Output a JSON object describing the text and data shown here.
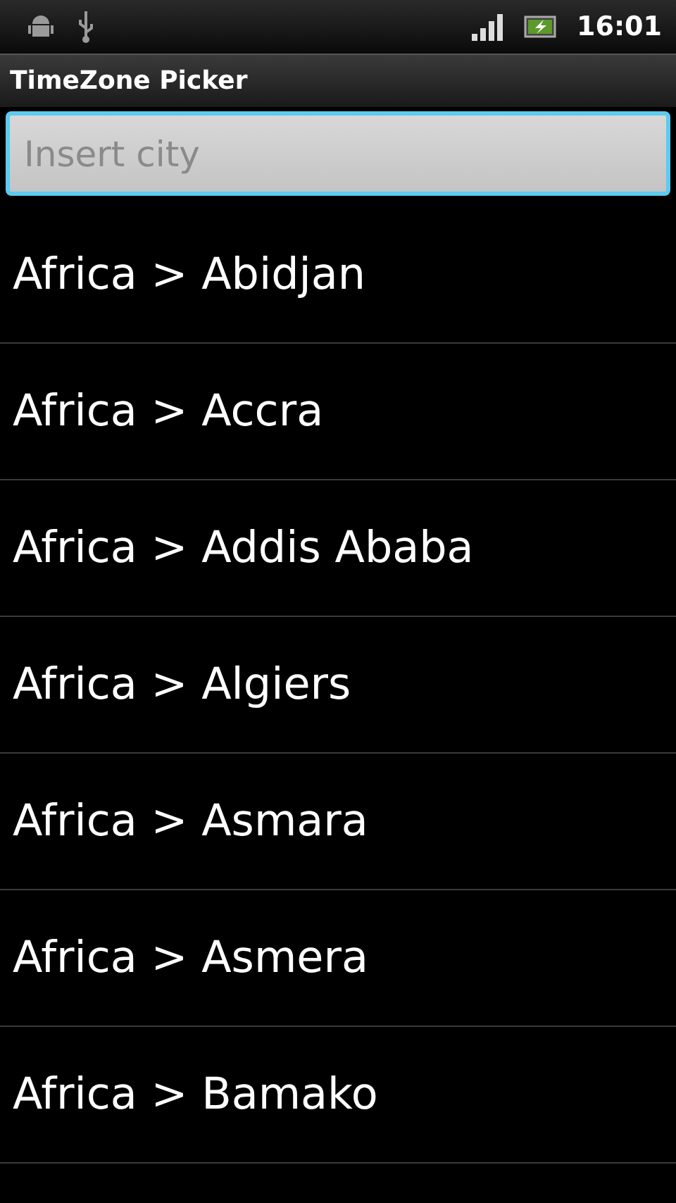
{
  "status_bar": {
    "time": "16:01"
  },
  "title_bar": {
    "title": "TimeZone Picker"
  },
  "search": {
    "placeholder": "Insert city"
  },
  "list": [
    {
      "label": "Africa > Abidjan"
    },
    {
      "label": "Africa > Accra"
    },
    {
      "label": "Africa > Addis Ababa"
    },
    {
      "label": "Africa > Algiers"
    },
    {
      "label": "Africa > Asmara"
    },
    {
      "label": "Africa > Asmera"
    },
    {
      "label": "Africa > Bamako"
    }
  ]
}
